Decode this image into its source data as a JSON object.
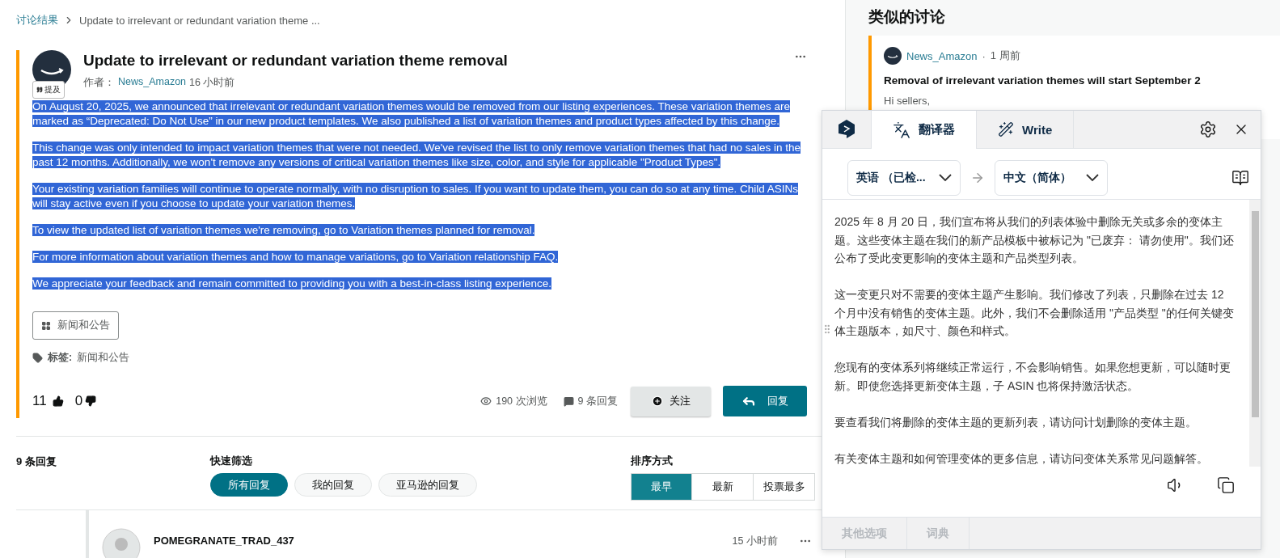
{
  "breadcrumb": {
    "parent": "讨论结果",
    "current": "Update to irrelevant or redundant variation theme ..."
  },
  "post": {
    "title": "Update to irrelevant or redundant variation theme removal",
    "author_label": "作者：",
    "author": "News_Amazon",
    "time": "16 小时前",
    "mention": "提及",
    "body_selected": true,
    "paragraphs": [
      "On August 20, 2025, we announced that irrelevant or redundant variation themes would be removed from our listing experiences. These variation themes are marked as “Deprecated: Do Not Use” in our new product templates. We also published a list of variation themes and product types affected by this change.",
      "This change was only intended to impact variation themes that were not needed. We've revised the list to only remove variation themes that had no sales in the past 12 months. Additionally, we won't remove any versions of critical variation themes like size, color, and style for applicable \"Product Types\".",
      "Your existing variation families will continue to operate normally, with no disruption to sales. If you want to update them, you can do so at any time. Child ASINs will stay active even if you choose to update your variation themes.",
      "To view the updated list of variation themes we're removing, go to Variation themes planned for removal.",
      "For more information about variation themes and how to manage variations, go to Variation relationship FAQ.",
      "We appreciate your feedback and remain committed to providing you with a best-in-class listing experience."
    ],
    "category": "新闻和公告",
    "tags_label": "标签:",
    "tags": "新闻和公告",
    "likes": "11",
    "dislikes": "0",
    "views": "190 次浏览",
    "replies": "9 条回复",
    "follow": "关注",
    "reply": "回复"
  },
  "replies_bar": {
    "count": "9 条回复",
    "filter_label": "快速筛选",
    "filters": [
      {
        "label": "所有回复",
        "selected": true
      },
      {
        "label": "我的回复",
        "selected": false
      },
      {
        "label": "亚马逊的回复",
        "selected": false
      }
    ],
    "sort_label": "排序方式",
    "sorts": [
      {
        "label": "最早",
        "selected": true
      },
      {
        "label": "最新",
        "selected": false
      },
      {
        "label": "投票最多",
        "selected": false
      }
    ]
  },
  "reply": {
    "author": "POMEGRANATE_TRAD_437",
    "time": "15 小时前"
  },
  "similar": {
    "title": "类似的讨论",
    "items": [
      {
        "author": "News_Amazon",
        "separator": "·",
        "time": "1 周前",
        "title": "Removal of irrelevant variation themes will start September 2",
        "excerpt": "Hi sellers,"
      }
    ]
  },
  "translator": {
    "tabs": [
      {
        "label": "翻译器",
        "selected": true
      },
      {
        "label": "Write",
        "selected": false
      }
    ],
    "source_lang": "英语 （已检...",
    "target_lang": "中文（简体）",
    "paragraphs": [
      "2025 年 8 月 20 日，我们宣布将从我们的列表体验中删除无关或多余的变体主题。这些变体主题在我们的新产品模板中被标记为 \"已废弃： 请勿使用\"。我们还公布了受此变更影响的变体主题和产品类型列表。",
      "这一变更只对不需要的变体主题产生影响。我们修改了列表，只删除在过去 12 个月中没有销售的变体主题。此外，我们不会删除适用 \"产品类型 \"的任何关键变体主题版本，如尺寸、颜色和样式。",
      "您现有的变体系列将继续正常运行，不会影响销售。如果您想更新，可以随时更新。即使您选择更新变体主题，子 ASIN 也将保持激活状态。",
      "要查看我们将删除的变体主题的更新列表，请访问计划删除的变体主题。",
      "有关变体主题和如何管理变体的更多信息，请访问变体关系常见问题解答。"
    ],
    "footer_tabs": [
      {
        "label": "其他选项",
        "disabled": true
      },
      {
        "label": "词典",
        "disabled": true
      }
    ]
  }
}
